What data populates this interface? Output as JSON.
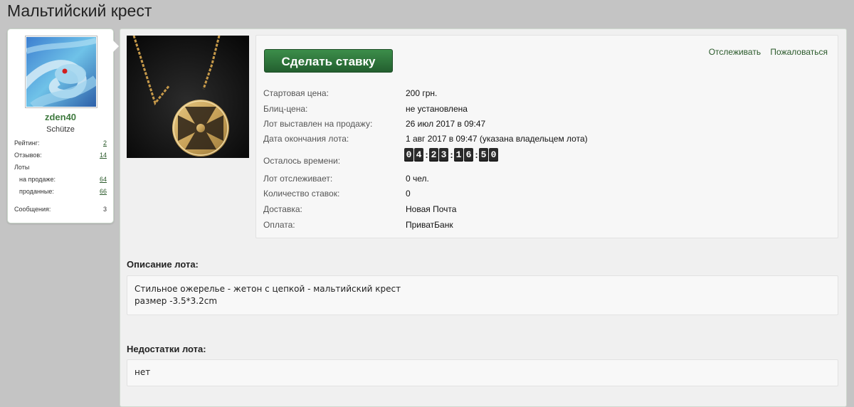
{
  "page": {
    "title": "Мальтийский крест"
  },
  "user": {
    "name": "zden40",
    "title": "Schütze",
    "stats": [
      {
        "label": "Рейтинг:",
        "value": "2"
      },
      {
        "label": "Отзывов:",
        "value": "14"
      },
      {
        "label": "Лоты",
        "value": ""
      },
      {
        "label": "на продаже:",
        "value": "64"
      },
      {
        "label": "проданные:",
        "value": "66"
      },
      {
        "label": "Сообщения:",
        "value": "3"
      }
    ]
  },
  "actions": {
    "bid_label": "Сделать ставку",
    "track_label": "Отслеживать",
    "report_label": "Пожаловаться"
  },
  "lot": {
    "fields": [
      {
        "label": "Стартовая цена:",
        "value": "200 грн."
      },
      {
        "label": "Блиц-цена:",
        "value": "не установлена"
      },
      {
        "label": "Лот выставлен на продажу:",
        "value": "26 июл 2017 в 09:47"
      },
      {
        "label": "Дата окончания лота:",
        "value": "1 авг 2017 в 09:47 (указана владельцем лота)"
      },
      {
        "label": "Осталось времени:",
        "value": ""
      },
      {
        "label": "Лот отслеживает:",
        "value": "0 чел."
      },
      {
        "label": "Количество ставок:",
        "value": "0"
      },
      {
        "label": "Доставка:",
        "value": "Новая Почта"
      },
      {
        "label": "Оплата:",
        "value": "ПриватБанк"
      }
    ],
    "countdown": [
      "0",
      "4",
      "2",
      "3",
      "1",
      "6",
      "5",
      "0"
    ]
  },
  "description": {
    "heading": "Описание лота:",
    "text": "Стильное ожерелье - жетон с цепкой - мальтийский крест\nразмер -3.5*3.2cm"
  },
  "defects": {
    "heading": "Недостатки лота:",
    "text": "нет"
  }
}
